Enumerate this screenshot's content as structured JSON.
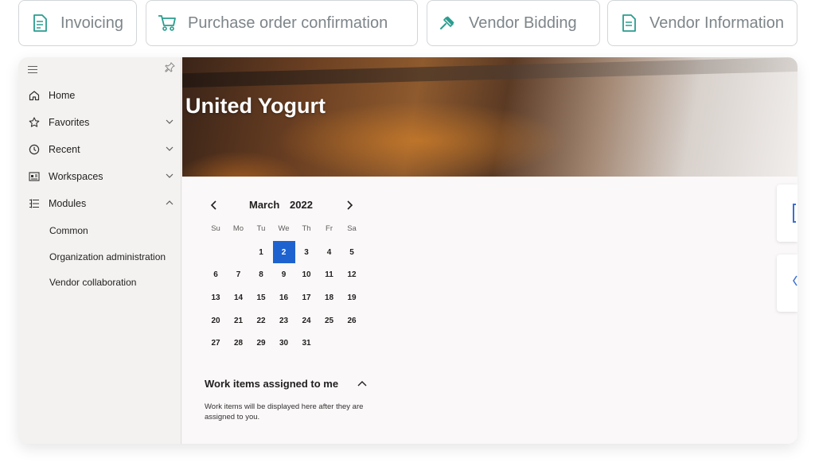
{
  "top_tabs": [
    {
      "label": "Invoicing",
      "icon": "invoice-document-icon"
    },
    {
      "label": "Purchase order confirmation",
      "icon": "shopping-cart-icon"
    },
    {
      "label": "Vendor Bidding",
      "icon": "gavel-icon"
    },
    {
      "label": "Vendor Information",
      "icon": "document-icon"
    }
  ],
  "colors": {
    "tab_icon": "#2a9d8f",
    "tab_text": "#7d8589",
    "selected_day": "#1e62cf"
  },
  "sidebar": {
    "nav": [
      {
        "label": "Home",
        "icon": "home-icon"
      },
      {
        "label": "Favorites",
        "icon": "star-icon",
        "chevron": "down"
      },
      {
        "label": "Recent",
        "icon": "clock-icon",
        "chevron": "down"
      },
      {
        "label": "Workspaces",
        "icon": "workspace-icon",
        "chevron": "down"
      },
      {
        "label": "Modules",
        "icon": "list-icon",
        "chevron": "up"
      }
    ],
    "modules": [
      "Common",
      "Organization administration",
      "Vendor collaboration"
    ]
  },
  "hero": {
    "title": "United Yogurt"
  },
  "calendar": {
    "month": "March",
    "year": "2022",
    "weekdays": [
      "Su",
      "Mo",
      "Tu",
      "We",
      "Th",
      "Fr",
      "Sa"
    ],
    "weeks": [
      [
        "",
        "",
        "1",
        "2",
        "3",
        "4",
        "5"
      ],
      [
        "6",
        "7",
        "8",
        "9",
        "10",
        "11",
        "12"
      ],
      [
        "13",
        "14",
        "15",
        "16",
        "17",
        "18",
        "19"
      ],
      [
        "20",
        "21",
        "22",
        "23",
        "24",
        "25",
        "26"
      ],
      [
        "27",
        "28",
        "29",
        "30",
        "31",
        "",
        ""
      ]
    ],
    "selected_day": "2"
  },
  "work_items": {
    "title": "Work items assigned to me",
    "empty_text": "Work items will be displayed here after they are assigned to you."
  }
}
